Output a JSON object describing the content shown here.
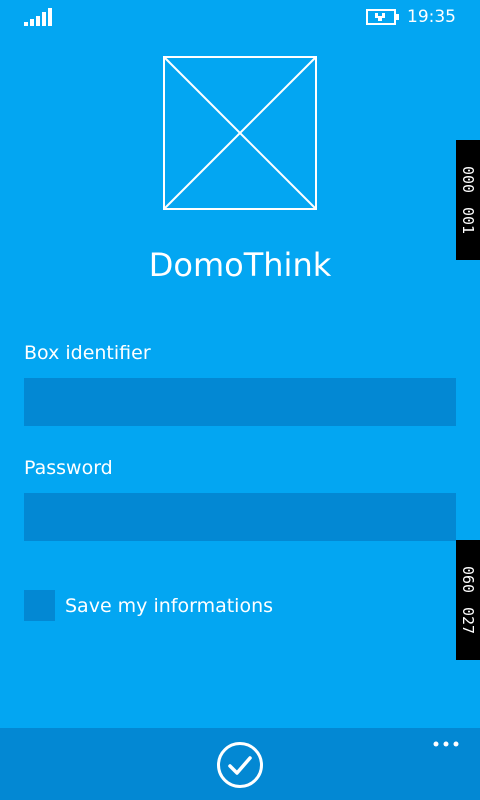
{
  "status_bar": {
    "time": "19:35",
    "signal_icon": "signal-bars-icon",
    "battery_icon": "battery-charging-icon"
  },
  "app": {
    "title": "DomoThink",
    "logo_icon": "placeholder-image-icon"
  },
  "form": {
    "box_identifier_label": "Box identifier",
    "box_identifier_value": "",
    "password_label": "Password",
    "password_value": "",
    "save_label": "Save my informations",
    "save_checked": false
  },
  "side_tabs": [
    {
      "top": "000",
      "bottom": "001"
    },
    {
      "top": "060",
      "bottom": "027"
    }
  ],
  "app_bar": {
    "confirm_icon": "check-circle-icon",
    "more_icon": "ellipsis-icon"
  },
  "colors": {
    "background": "#03a6f2",
    "field": "#0388d3",
    "app_bar": "#0388d3",
    "text": "#ffffff"
  }
}
